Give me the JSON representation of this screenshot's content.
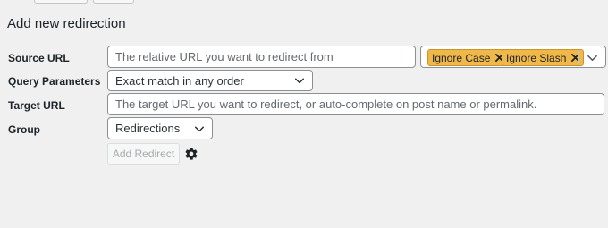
{
  "form": {
    "title": "Add new redirection",
    "source": {
      "label": "Source URL",
      "placeholder": "The relative URL you want to redirect from",
      "flags": [
        "Ignore Case",
        "Ignore Slash"
      ]
    },
    "query": {
      "label": "Query Parameters",
      "selected": "Exact match in any order"
    },
    "target": {
      "label": "Target URL",
      "placeholder": "The target URL you want to redirect, or auto-complete on post name or permalink."
    },
    "group": {
      "label": "Group",
      "selected": "Redirections"
    },
    "submit_label": "Add Redirect",
    "settings_icon": "gear-icon"
  },
  "colors": {
    "background": "#f0f0f1",
    "badge": "#f0b849",
    "border": "#8c8f94"
  }
}
